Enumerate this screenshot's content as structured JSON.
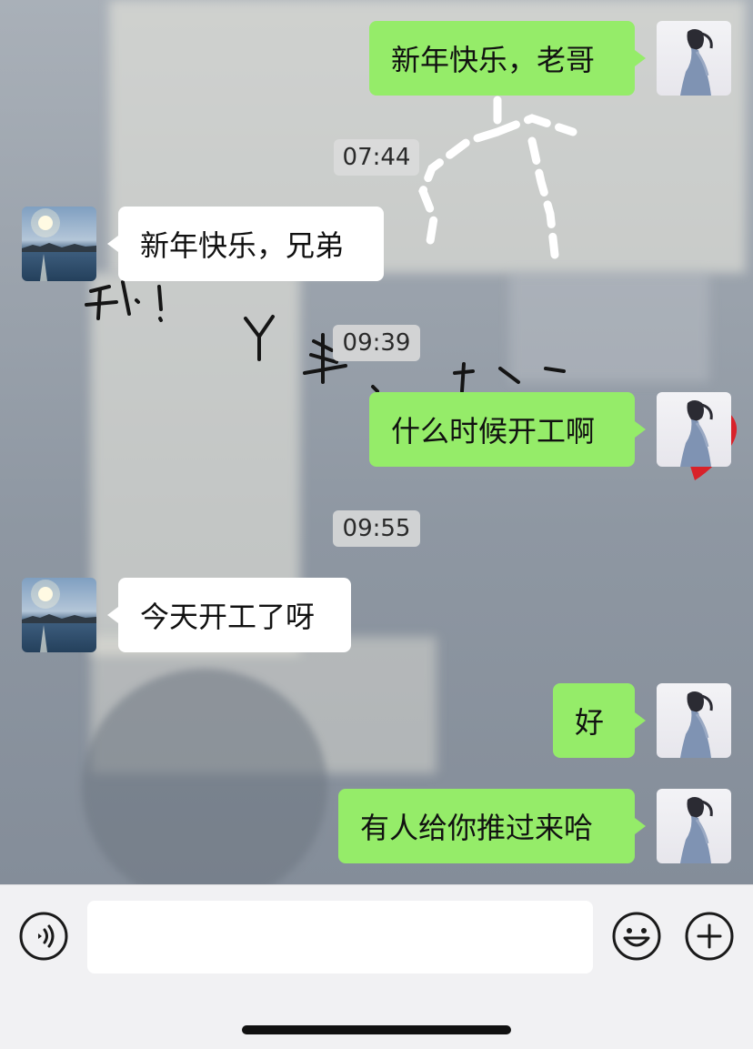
{
  "messages": [
    {
      "side": "me",
      "text": "新年快乐，老哥"
    },
    {
      "timestamp": "07:44"
    },
    {
      "side": "friend",
      "text": "新年快乐，兄弟"
    },
    {
      "timestamp": "09:39"
    },
    {
      "side": "me",
      "text": "什么时候开工啊"
    },
    {
      "timestamp": "09:55"
    },
    {
      "side": "friend",
      "text": "今天开工了呀"
    },
    {
      "side": "me",
      "text": "好"
    },
    {
      "side": "me",
      "text": "有人给你推过来哈"
    }
  ],
  "input_bar": {
    "voice_icon": "voice-icon",
    "emoji_icon": "emoji-icon",
    "add_icon": "plus-icon",
    "input_value": ""
  },
  "colors": {
    "my_bubble": "#95ec69",
    "friend_bubble": "#ffffff",
    "input_bar_bg": "#f1f1f3"
  }
}
